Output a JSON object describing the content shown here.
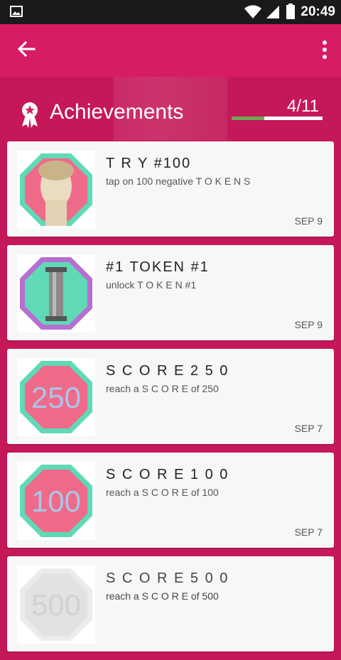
{
  "status_bar": {
    "time": "20:49",
    "icons": [
      "image-icon",
      "wifi-icon",
      "signal-icon",
      "battery-icon"
    ]
  },
  "app_bar": {
    "back_icon": "arrow-left-icon",
    "menu_icon": "more-vertical-icon"
  },
  "header": {
    "icon": "award-ribbon-icon",
    "title": "Achievements",
    "count": "4/11",
    "progress_fraction": 0.36
  },
  "achievements": [
    {
      "name": "T R Y #100",
      "description": "tap on 100 negative T O K E N S",
      "date": "SEP 9",
      "thumb": "statue-head",
      "locked": false
    },
    {
      "name": "#1 TOKEN #1",
      "description": "unlock T O K E N #1",
      "date": "SEP 9",
      "thumb": "column",
      "locked": false
    },
    {
      "name": "S C O R E 2 5 0",
      "description": "reach a S C O R E of 250",
      "date": "SEP 7",
      "thumb": "250",
      "locked": false
    },
    {
      "name": "S C O R E 1 0 0",
      "description": "reach a S C O R E of 100",
      "date": "SEP 7",
      "thumb": "100",
      "locked": false
    },
    {
      "name": "S C O R E 5 0 0",
      "description": "reach a S C O R E of 500",
      "date": "",
      "thumb": "500",
      "locked": true
    }
  ],
  "colors": {
    "background": "#c5185a",
    "app_bar": "#d81b65",
    "progress_fill": "#6aa84f",
    "octagon_pink": "#f06a8a",
    "octagon_mint": "#5fd9b6",
    "octagon_purple": "#b66fd0"
  }
}
